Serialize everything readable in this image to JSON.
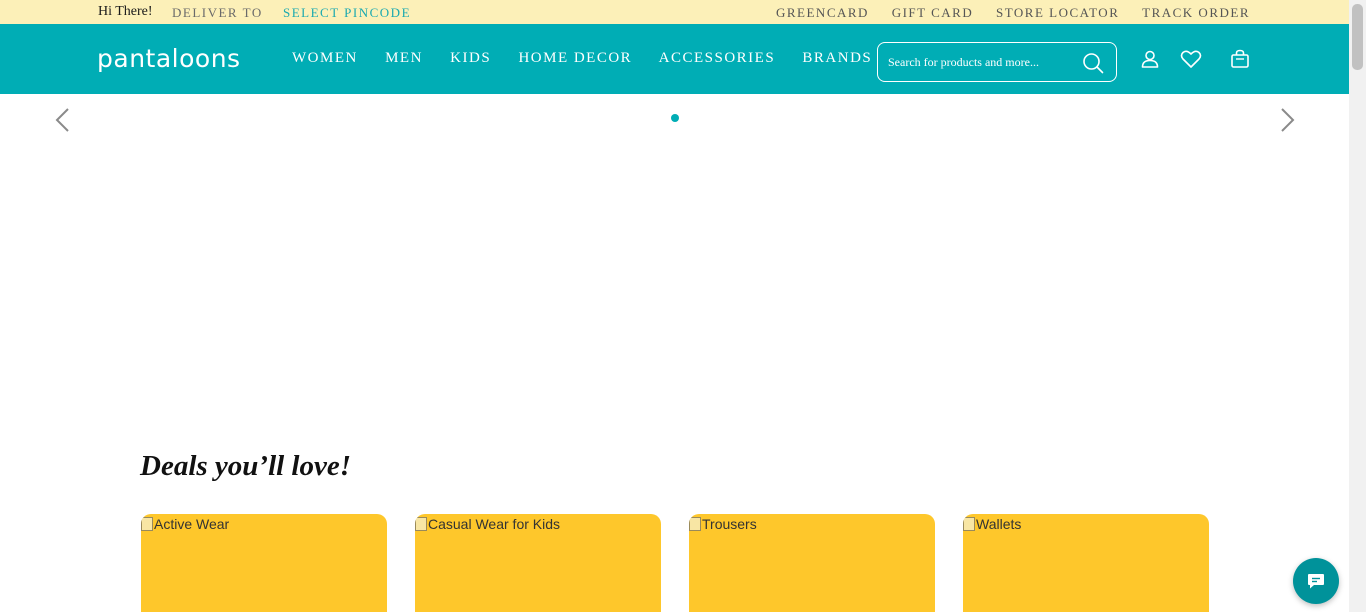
{
  "topbar": {
    "greeting": "Hi There!",
    "deliver_label": "DELIVER TO",
    "pincode_link": "SELECT PINCODE",
    "links": [
      "GREENCARD",
      "GIFT CARD",
      "STORE LOCATOR",
      "TRACK ORDER"
    ]
  },
  "header": {
    "logo": "pantaloons",
    "nav": [
      "WOMEN",
      "MEN",
      "KIDS",
      "HOME DECOR",
      "ACCESSORIES",
      "BRANDS"
    ],
    "search_placeholder": "Search for products and more...",
    "icons": [
      "search-icon",
      "user-icon",
      "heart-icon",
      "bag-icon"
    ]
  },
  "carousel": {
    "icons": [
      "chevron-left-icon",
      "chevron-right-icon"
    ],
    "dots": 1
  },
  "deals": {
    "title": "Deals you’ll love!",
    "cards": [
      {
        "alt": "Active Wear"
      },
      {
        "alt": "Casual Wear for Kids"
      },
      {
        "alt": "Trousers"
      },
      {
        "alt": "Wallets"
      }
    ]
  },
  "colors": {
    "topbar_bg": "#fcf0b8",
    "header_bg": "#00adb5",
    "accent": "#1aa9b0",
    "card_bg": "#fec72b",
    "chat_bg": "#00929a"
  },
  "chat": {
    "icon": "chat-bubble-icon"
  }
}
